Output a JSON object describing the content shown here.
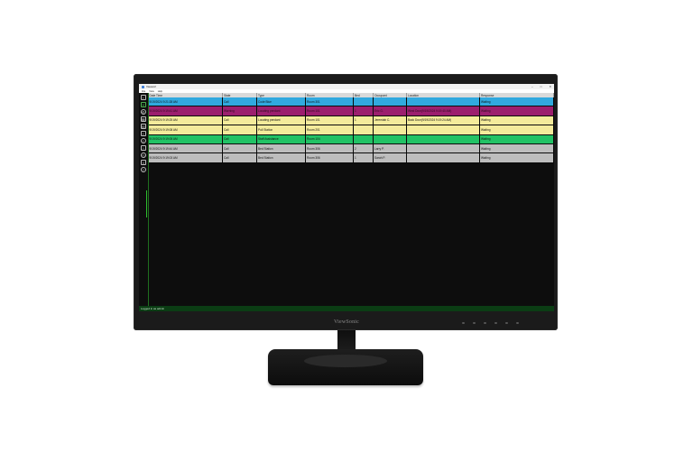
{
  "monitor": {
    "brand": "ViewSonic"
  },
  "window": {
    "title": "Viewer2",
    "controls": [
      "–",
      "□",
      "✕"
    ]
  },
  "menu": [
    "File",
    "View",
    "Help"
  ],
  "toolbar": {
    "icons": [
      "add-icon",
      "tools-icon",
      "settings-icon",
      "calendar-icon",
      "chart-icon",
      "document-icon",
      "group-icon",
      "warning-icon",
      "clock-icon",
      "pause-icon",
      "help-icon"
    ]
  },
  "table": {
    "columns": [
      "Date Time",
      "State",
      "Type",
      "Room",
      "Bed",
      "Occupant",
      "Location",
      "Response"
    ],
    "rows": [
      {
        "cells": [
          "9/19/2024 9:21:28 AM",
          "Call",
          "Code Blue",
          "Room 301",
          "",
          "",
          "",
          "Waiting"
        ],
        "bg": "#31a9df"
      },
      {
        "cells": [
          "9/19/2024 9:19:41 AM",
          "Warning",
          "Locating pendant",
          "Room 101",
          "1",
          "Eric G.",
          "West Door(9/19/2024 9:19:40 AM)",
          "Waiting"
        ],
        "bg": "#9c1f6e"
      },
      {
        "cells": [
          "9/19/2024 9:19:25 AM",
          "Call",
          "Locating pendant",
          "Room 101",
          "1",
          "Jeremiah C.",
          "Back Door(9/19/2024 9:19:24 AM)",
          "Waiting"
        ],
        "bg": "#f4eb9b"
      },
      {
        "cells": [
          "9/19/2024 9:19:08 AM",
          "Call",
          "Pull Station",
          "Room 201",
          "",
          "",
          "",
          "Waiting"
        ],
        "bg": "#f4eb9b"
      },
      {
        "cells": [
          "9/19/2024 9:19:05 AM",
          "Call",
          "Staff Assistance",
          "Room 104",
          "",
          "",
          "",
          "Waiting"
        ],
        "bg": "#22c265"
      },
      {
        "cells": [
          "9/19/2024 9:19:44 AM",
          "Call",
          "Bed Station",
          "Room 306",
          "2",
          "Larry P.",
          "",
          "Waiting"
        ],
        "bg": "#bdbdbd"
      },
      {
        "cells": [
          "9/19/2024 9:19:03 AM",
          "Call",
          "Bed Station",
          "Room 306",
          "1",
          "Sarah P.",
          "",
          "Waiting"
        ],
        "bg": "#bdbdbd"
      }
    ]
  },
  "status": {
    "text": "Logged in as admin"
  }
}
